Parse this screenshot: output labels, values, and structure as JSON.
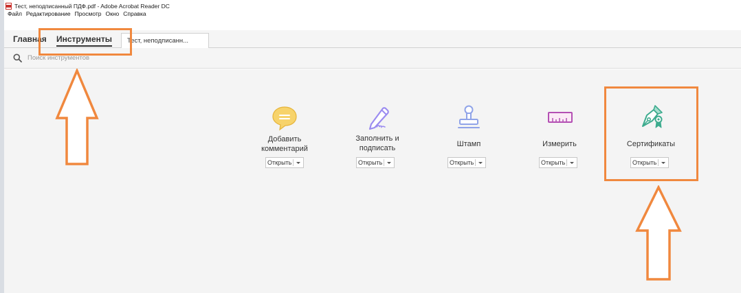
{
  "window": {
    "title": "Тест, неподписанный ПДФ.pdf - Adobe Acrobat Reader DC"
  },
  "menu": [
    "Файл",
    "Редактирование",
    "Просмотр",
    "Окно",
    "Справка"
  ],
  "tabs": {
    "home": "Главная",
    "tools": "Инструменты",
    "document": "Тест, неподписанн..."
  },
  "search": {
    "placeholder": "Поиск инструментов"
  },
  "tools": [
    {
      "line1": "Добавить",
      "line2": "комментарий",
      "button": "Открыть",
      "icon": "comment-bubble-icon",
      "color": "#f5c24c"
    },
    {
      "line1": "Заполнить и",
      "line2": "подписать",
      "button": "Открыть",
      "icon": "pen-sign-icon",
      "color": "#9b8cf0"
    },
    {
      "line1": "Штамп",
      "line2": "",
      "button": "Открыть",
      "icon": "stamp-icon",
      "color": "#8fa3e8"
    },
    {
      "line1": "Измерить",
      "line2": "",
      "button": "Открыть",
      "icon": "ruler-icon",
      "color": "#b34fb3"
    },
    {
      "line1": "Сертификаты",
      "line2": "",
      "button": "Открыть",
      "icon": "certificate-pen-icon",
      "color": "#3dab8e"
    }
  ],
  "colors": {
    "annotation": "#f0883e",
    "pdf_red": "#c9302c"
  }
}
